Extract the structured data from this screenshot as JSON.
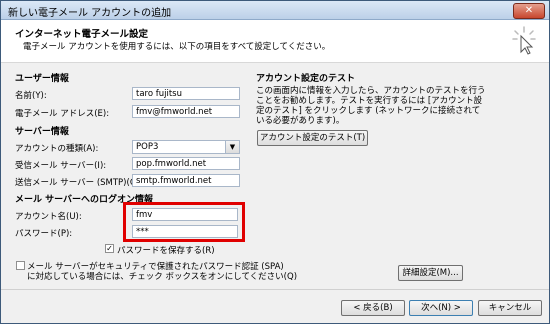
{
  "window": {
    "title": "新しい電子メール アカウントの追加",
    "close": "✕"
  },
  "header": {
    "title": "インターネット電子メール設定",
    "subtitle": "電子メール アカウントを使用するには、以下の項目をすべて設定してください。"
  },
  "user_info": {
    "heading": "ユーザー情報",
    "name_label": "名前(Y):",
    "name_value": "taro fujitsu",
    "email_label": "電子メール アドレス(E):",
    "email_value": "fmv@fmworld.net"
  },
  "server_info": {
    "heading": "サーバー情報",
    "type_label": "アカウントの種類(A):",
    "type_value": "POP3",
    "incoming_label": "受信メール サーバー(I):",
    "incoming_value": "pop.fmworld.net",
    "outgoing_label": "送信メール サーバー (SMTP)(O):",
    "outgoing_value": "smtp.fmworld.net"
  },
  "logon": {
    "heading": "メール サーバーへのログオン情報",
    "account_label": "アカウント名(U):",
    "account_value": "fmv",
    "password_label": "パスワード(P):",
    "password_value": "***",
    "save_password_label": "パスワードを保存する(R)",
    "save_password_checked": true,
    "spa_label_line1": "メール サーバーがセキュリティで保護されたパスワード認証 (SPA)",
    "spa_label_line2": "に対応している場合には、チェック ボックスをオンにしてください(Q)",
    "spa_checked": false
  },
  "test": {
    "heading": "アカウント設定のテスト",
    "description": "この画面内に情報を入力したら、アカウントのテストを行うことをお勧めします。テストを実行するには [アカウント設定のテスト] をクリックします (ネットワークに接続されている必要があります)。",
    "button": "アカウント設定のテスト(T)"
  },
  "more_settings_button": "詳細設定(M)...",
  "footer": {
    "back": "< 戻る(B)",
    "next": "次へ(N) >",
    "cancel": "キャンセル"
  },
  "colors": {
    "highlight": "#e00000",
    "accent": "#3d5a7a"
  }
}
